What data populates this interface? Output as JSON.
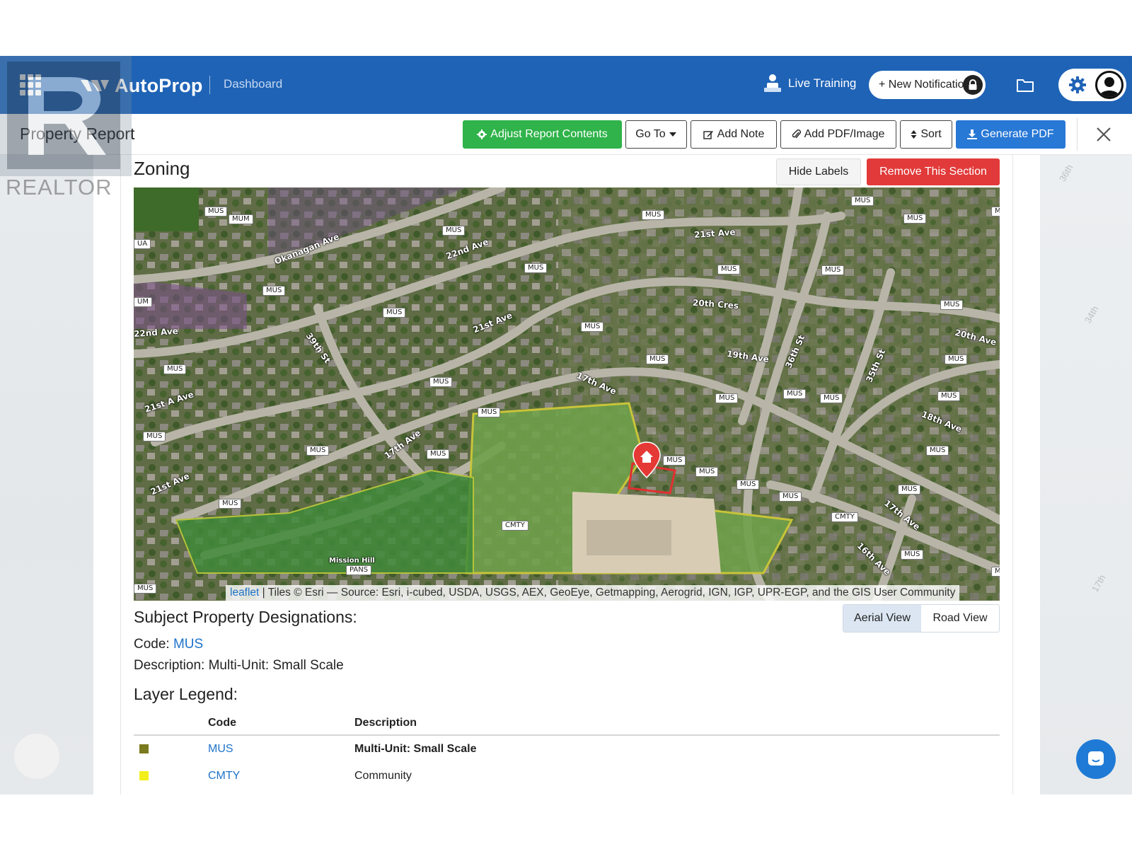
{
  "topbar": {
    "brand": "AutoProp",
    "dashboard_link": "Dashboard",
    "live_training": "Live Training",
    "new_notification": "+ New Notification"
  },
  "header": {
    "title": "Property Report",
    "buttons": {
      "adjust": "Adjust Report Contents",
      "goto": "Go To",
      "add_note": "Add Note",
      "add_pdf": "Add PDF/Image",
      "sort": "Sort",
      "generate": "Generate PDF"
    }
  },
  "section": {
    "title": "Zoning",
    "hide_labels": "Hide Labels",
    "remove": "Remove This Section"
  },
  "map": {
    "attribution_link": "leaflet",
    "attribution_text": " | Tiles © Esri — Source: Esri, i-cubed, USDA, USGS, AEX, GeoEye, Getmapping, Aerogrid, IGN, IGP, UPR-EGP, and the GIS User Community",
    "zone_labels": [
      "MUS",
      "MUM",
      "UA",
      "UM",
      "MUS",
      "MUS",
      "MUS",
      "MUS",
      "MUS",
      "MUS",
      "MUS",
      "MUS",
      "MUS",
      "MUS",
      "MUS",
      "MUS",
      "MUS",
      "MUS",
      "MUS",
      "MUS",
      "MUS",
      "MUS",
      "MUS",
      "MUS",
      "MUS",
      "MUS",
      "MUS",
      "MUS",
      "MUS",
      "MUS",
      "MUS",
      "MUS",
      "MUS",
      "MUS",
      "MUS",
      "MUS",
      "CMTY",
      "CMTY",
      "PANS",
      "M",
      "M"
    ],
    "street_labels": [
      "Okanagan Ave",
      "22nd Ave",
      "21st Ave",
      "21st Ave",
      "20th Cres",
      "19th Ave",
      "20th Ave",
      "22nd Ave",
      "39th St",
      "36th St",
      "35th St",
      "21st A Ave",
      "17th Ave",
      "17th Ave",
      "18th Ave",
      "17th Ave",
      "21st Ave",
      "16th Ave",
      "Mission Hill"
    ],
    "views": {
      "aerial": "Aerial View",
      "road": "Road View",
      "active": "aerial"
    }
  },
  "designations": {
    "heading": "Subject Property Designations:",
    "code_label": "Code: ",
    "code_value": "MUS",
    "description": "Description: Multi-Unit: Small Scale"
  },
  "legend": {
    "heading": "Layer Legend:",
    "columns": [
      "Code",
      "Description"
    ],
    "rows": [
      {
        "code": "MUS",
        "description": "Multi-Unit: Small Scale",
        "color": "#7a7a1e"
      },
      {
        "code": "CMTY",
        "description": "Community",
        "color": "#f2ef1c"
      }
    ]
  },
  "watermark": {
    "text": "REALTOR"
  },
  "colors": {
    "topbar": "#1f63b6",
    "green": "#2fb34a",
    "blue": "#2878d6",
    "red": "#e23a3a",
    "link": "#1f73c9"
  }
}
